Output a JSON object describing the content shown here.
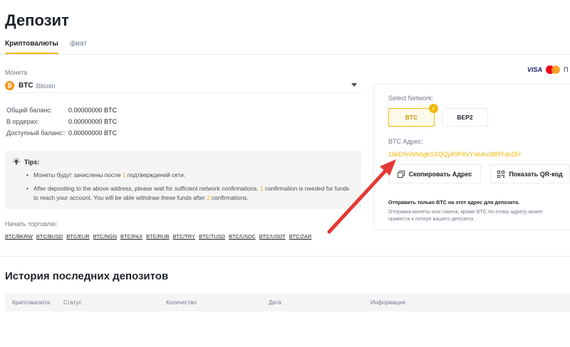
{
  "page": {
    "title": "Депозит"
  },
  "tabs": [
    {
      "label": "Криптовалюты",
      "active": true
    },
    {
      "label": "фиат",
      "active": false
    }
  ],
  "coin": {
    "label": "Монета",
    "icon": "bitcoin-icon",
    "icon_glyph": "₿",
    "symbol": "BTC",
    "name": "Bitcoin"
  },
  "balances": [
    {
      "label": "Общий баланс:",
      "value": "0.00000000 BTC"
    },
    {
      "label": "В ордерах:",
      "value": "0.00000000 BTC"
    },
    {
      "label": "Доступный баланс::",
      "value": "0.00000000 BTC"
    }
  ],
  "tips": {
    "title": "Tips:",
    "tip1": {
      "before": "Монеты будут зачислены после ",
      "num": "1",
      "after": " подтверждений сети."
    },
    "tip2": {
      "p1": "After depositing to the above address, please wait for sufficient network confirmations. ",
      "n1": "1",
      "p2": " confirmation is needed for funds to reach your account. You will be able withdraw these funds after ",
      "n2": "2",
      "p3": " confirmations."
    }
  },
  "trade": {
    "label": "Начать торговлю:",
    "pairs": [
      "BTC/BKRW",
      "BTC/BUSD",
      "BTC/EUR",
      "BTC/NGN",
      "BTC/PAX",
      "BTC/RUB",
      "BTC/TRY",
      "BTC/TUSD",
      "BTC/USDC",
      "BTC/USDT",
      "BTC/ZAR"
    ]
  },
  "payment_logos": {
    "visa": "VISA",
    "more": "П"
  },
  "deposit": {
    "network_label": "Select Network:",
    "networks": [
      {
        "label": "BTC",
        "selected": true
      },
      {
        "label": "BEP2",
        "selected": false
      }
    ],
    "address_label": "BTC Адрес:",
    "address": "16kDXnNN6gkSXQQpRtP4VYnbAu3M9YdoDH",
    "copy_label": "Скопировать Адрес",
    "qr_label": "Показать QR-код",
    "note_bold": "Отправить только BTC на этот адрес для депозита.",
    "note": "Отправка монеты или токена, кроме BTC по этому адресу может привести к потере вашего депозита."
  },
  "history": {
    "title": "История последних депозитов",
    "columns": [
      "Криптовалюта",
      "Статус",
      "Количество",
      "Дата",
      "Информация"
    ]
  },
  "colors": {
    "accent": "#f0b90b",
    "arrow": "#e53935",
    "bitcoin": "#f7931a"
  }
}
